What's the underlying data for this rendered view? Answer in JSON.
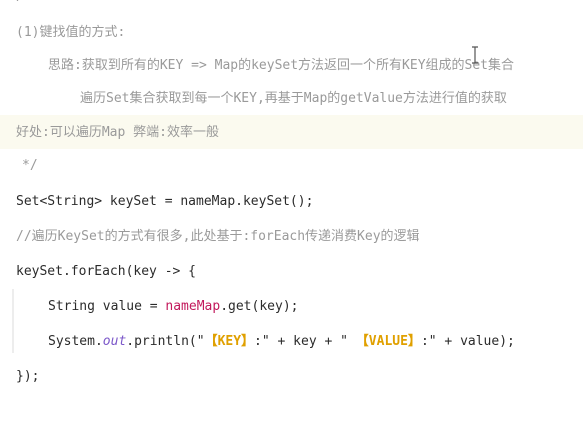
{
  "code": {
    "comment_title": "(1)键找值的方式:",
    "comment_idea_1": "思路:获取到所有的KEY => Map的keySet方法返回一个所有KEY组成的Set集合",
    "comment_idea_2": "遍历Set集合获取到每一个KEY,再基于Map的getValue方法进行值的获取",
    "comment_pros_cons": "好处:可以遍历Map 弊端:效率一般",
    "comment_end": "*/",
    "line_keyset": "Set<String> keySet = nameMap.keySet();",
    "comment_foreach": "//遍历KeySet的方式有很多,此处基于:forEach传递消费Key的逻辑",
    "line_foreach_open": "keySet.forEach(key -> {",
    "line_value_prefix": "String value = ",
    "line_value_field": "nameMap",
    "line_value_suffix": ".get(key);",
    "println_prefix": "System.",
    "println_out": "out",
    "println_mid1": ".println(\"",
    "key_tag": "【KEY】",
    "println_mid2": ":\" + key + \" ",
    "value_tag": "【VALUE】",
    "println_end": ":\" + value);",
    "line_close": "});"
  }
}
